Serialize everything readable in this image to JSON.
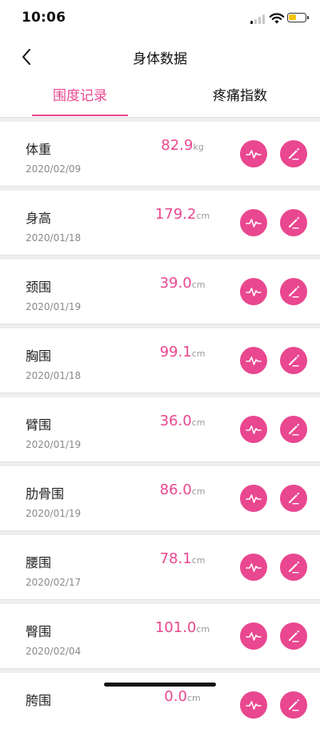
{
  "status_bar": {
    "time": "10:06",
    "battery_color": "#f3c300",
    "battery_level": 0.45
  },
  "nav": {
    "title": "身体数据",
    "back_icon": "chevron-left-icon"
  },
  "tabs": [
    {
      "label": "围度记录",
      "active": true
    },
    {
      "label": "疼痛指数",
      "active": false
    }
  ],
  "colors": {
    "accent": "#e9478f",
    "divider": "#eeeeee",
    "text": "#222222",
    "muted": "#8a8a8a"
  },
  "records": [
    {
      "name": "体重",
      "date": "2020/02/09",
      "value": "82.9",
      "unit": "kg"
    },
    {
      "name": "身高",
      "date": "2020/01/18",
      "value": "179.2",
      "unit": "cm"
    },
    {
      "name": "颈围",
      "date": "2020/01/19",
      "value": "39.0",
      "unit": "cm"
    },
    {
      "name": "胸围",
      "date": "2020/01/18",
      "value": "99.1",
      "unit": "cm"
    },
    {
      "name": "臂围",
      "date": "2020/01/19",
      "value": "36.0",
      "unit": "cm"
    },
    {
      "name": "肋骨围",
      "date": "2020/01/19",
      "value": "86.0",
      "unit": "cm"
    },
    {
      "name": "腰围",
      "date": "2020/02/17",
      "value": "78.1",
      "unit": "cm"
    },
    {
      "name": "臀围",
      "date": "2020/02/04",
      "value": "101.0",
      "unit": "cm"
    },
    {
      "name": "胯围",
      "date": "",
      "value": "0.0",
      "unit": "cm"
    }
  ],
  "icons": {
    "chart": "trend-chart-icon",
    "edit": "pencil-icon"
  }
}
